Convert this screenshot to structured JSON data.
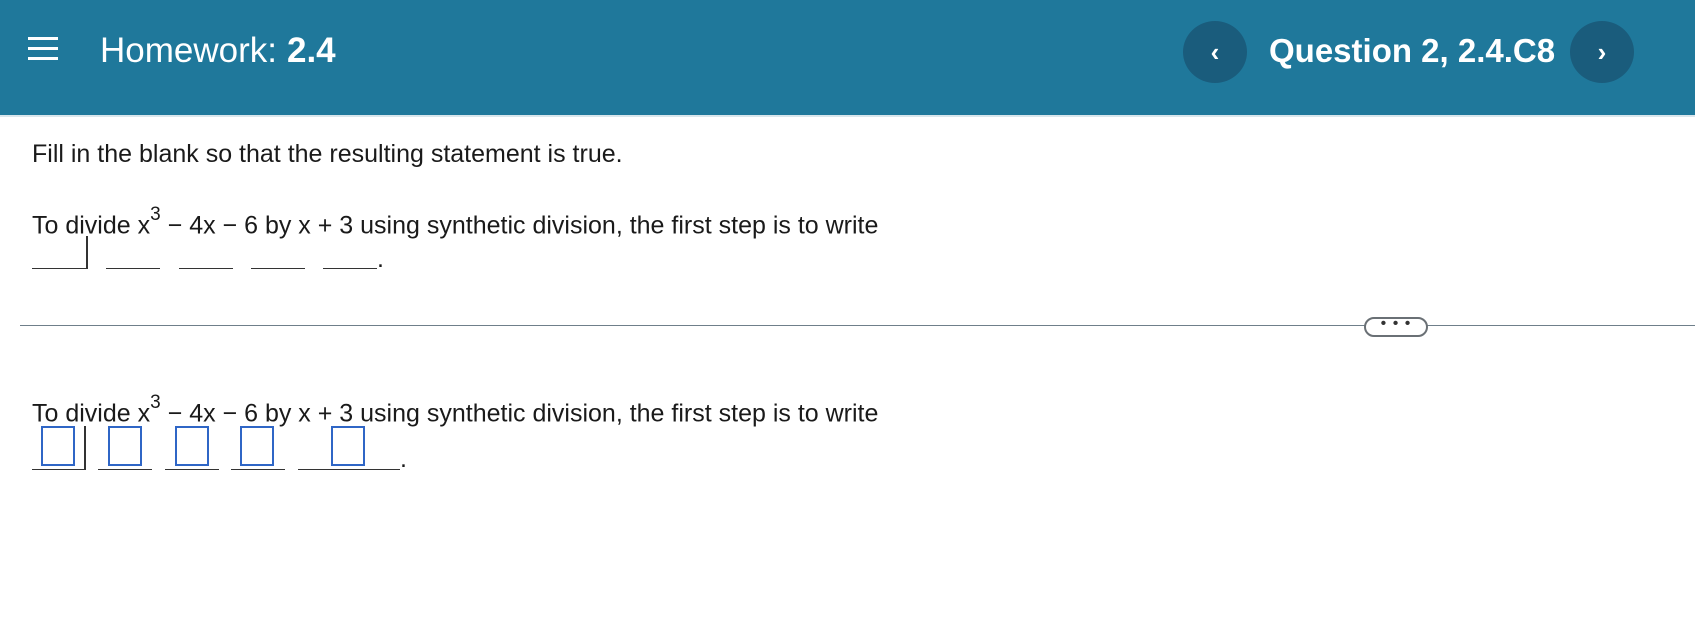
{
  "header": {
    "menu_icon": "hamburger-menu-icon",
    "homework_label": "Homework:",
    "homework_number": "2.4",
    "prev_glyph": "‹",
    "next_glyph": "›",
    "question_title": "Question 2, 2.4.C8",
    "background_color": "#1f789b",
    "button_color": "#1a5c7c"
  },
  "question": {
    "instruction": "Fill in the blank so that the resulting statement is true.",
    "prompt_before_exp": "To divide x",
    "exponent": "3",
    "prompt_after_exp": " − 4x − 6 by x + 3 using synthetic division, the first step is to write",
    "period": "."
  },
  "divider": {
    "glyph": "• • •"
  },
  "answer": {
    "prompt_before_exp": "To divide x",
    "exponent": "3",
    "prompt_after_exp": " − 4x − 6 by x + 3 using synthetic division, the first step is to write",
    "period": ".",
    "inputs": [
      "",
      "",
      "",
      "",
      ""
    ],
    "input_border_color": "#2f66c6"
  }
}
